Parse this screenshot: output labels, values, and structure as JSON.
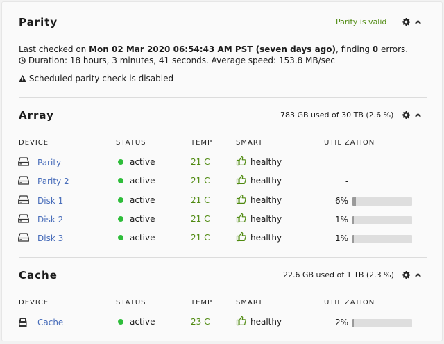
{
  "parity": {
    "title": "Parity",
    "status": "Parity is valid",
    "last_checked_prefix": "Last checked on ",
    "last_checked_date": "Mon 02 Mar 2020 06:54:43 AM PST (seven days ago)",
    "last_checked_mid": ", finding ",
    "errors": "0",
    "last_checked_suffix": " errors.",
    "duration": "Duration: 18 hours, 3 minutes, 41 seconds. Average speed: 153.8 MB/sec",
    "scheduled": "Scheduled parity check is disabled"
  },
  "array": {
    "title": "Array",
    "summary": "783 GB used of 30 TB (2.6 %)",
    "columns": [
      "DEVICE",
      "STATUS",
      "TEMP",
      "SMART",
      "UTILIZATION"
    ],
    "rows": [
      {
        "name": "Parity",
        "status": "active",
        "temp": "21 C",
        "smart": "healthy",
        "util": "-",
        "fill": null
      },
      {
        "name": "Parity 2",
        "status": "active",
        "temp": "21 C",
        "smart": "healthy",
        "util": "-",
        "fill": null
      },
      {
        "name": "Disk 1",
        "status": "active",
        "temp": "21 C",
        "smart": "healthy",
        "util": "6%",
        "fill": 0.06
      },
      {
        "name": "Disk 2",
        "status": "active",
        "temp": "21 C",
        "smart": "healthy",
        "util": "1%",
        "fill": 0.01
      },
      {
        "name": "Disk 3",
        "status": "active",
        "temp": "21 C",
        "smart": "healthy",
        "util": "1%",
        "fill": 0.01
      }
    ]
  },
  "cache": {
    "title": "Cache",
    "summary": "22.6 GB used of 1 TB (2.3 %)",
    "columns": [
      "DEVICE",
      "STATUS",
      "TEMP",
      "SMART",
      "UTILIZATION"
    ],
    "rows": [
      {
        "name": "Cache",
        "status": "active",
        "temp": "23 C",
        "smart": "healthy",
        "util": "2%",
        "fill": 0.02
      }
    ]
  },
  "colors": {
    "valid_green": "#4f8a10",
    "status_dot": "#2ebd3a",
    "device_link": "#486dba"
  },
  "icons": {
    "settings": "gear-icon",
    "collapse": "chevron-up-icon",
    "duration": "clock-icon",
    "warning": "warning-icon",
    "disk": "hdd-icon",
    "cache_disk": "ssd-icon",
    "smart": "thumbs-up-icon"
  }
}
